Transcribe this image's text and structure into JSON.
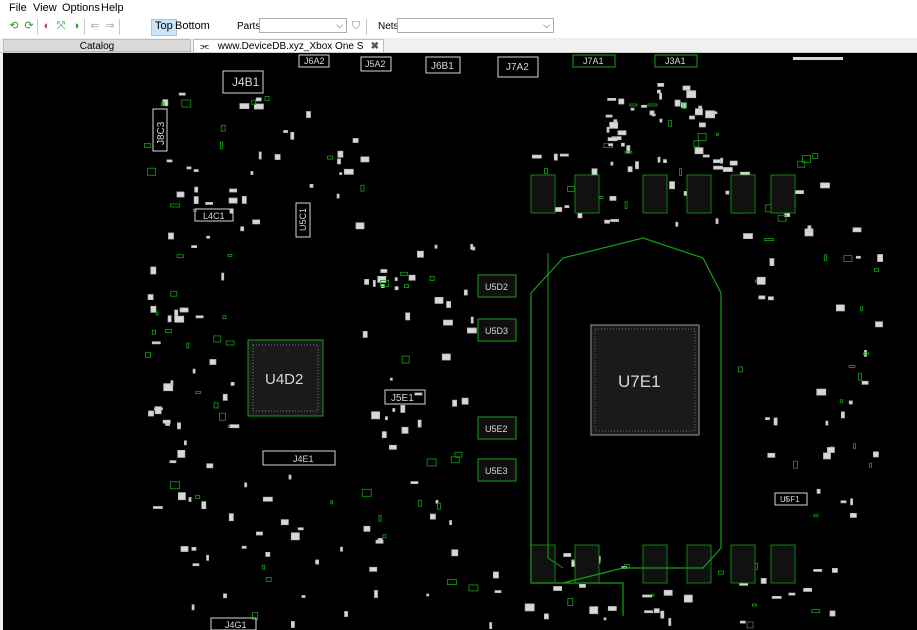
{
  "menu": {
    "file": "File",
    "view": "View",
    "options": "Options",
    "help": "Help"
  },
  "toolbar": {
    "top_label": "Top",
    "bottom_label": "Bottom",
    "parts_label": "Parts:",
    "parts_value": "",
    "nets_label": "Nets:",
    "nets_value": "",
    "icons": [
      "refresh-green-icon",
      "refresh-green-icon",
      "zoom-out-icon",
      "zoom-fit-icon",
      "zoom-in-icon",
      "arrow-left-icon",
      "arrow-right-icon"
    ]
  },
  "tabs": {
    "catalog": "Catalog",
    "board": "www.DeviceDB.xyz_Xbox One S Edmonton"
  },
  "board": {
    "labels": {
      "j4b1": "J4B1",
      "j6a2": "J6A2",
      "j5a2": "J5A2",
      "j6b1": "J6B1",
      "j7a2": "J7A2",
      "j7a1": "J7A1",
      "j3a1": "J3A1",
      "j8c3": "J8C3",
      "l4c1": "L4C1",
      "u5c1": "U5C1",
      "u5d2": "U5D2",
      "u5d3": "U5D3",
      "u5e2": "U5E2",
      "u5e3": "U5E3",
      "u4d2": "U4D2",
      "u7e1": "U7E1",
      "j5e1": "J5E1",
      "j4e1": "J4E1",
      "j4g1": "J4G1",
      "u5f1": "U5F1"
    },
    "colors": {
      "trace": "#16a016",
      "pad": "#d8d8d8",
      "background": "#000000"
    }
  }
}
